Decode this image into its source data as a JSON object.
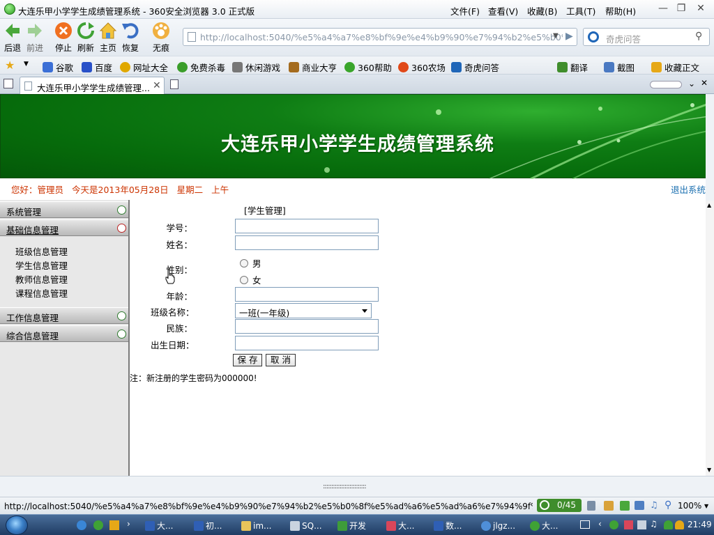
{
  "window": {
    "title": "大连乐甲小学学生成绩管理系统 - 360安全浏览器 3.0 正式版",
    "menus": [
      "文件(F)",
      "查看(V)",
      "收藏(B)",
      "工具(T)",
      "帮助(H)"
    ]
  },
  "toolbar": {
    "back": "后退",
    "forward": "前进",
    "stop": "停止",
    "refresh": "刷新",
    "home": "主页",
    "restore": "恢复",
    "incognito": "无痕"
  },
  "address": {
    "url": "http://localhost:5040/%e5%a4%a7%e8%bf%9e%e4%b9%90%e7%94%b2%e5%b0%",
    "search_placeholder": "奇虎问答"
  },
  "favorites": [
    "谷歌",
    "百度",
    "网址大全",
    "免费杀毒",
    "休闲游戏",
    "商业大亨",
    "360帮助",
    "360农场",
    "奇虎问答"
  ],
  "tools_right": [
    "翻译",
    "截图",
    "收藏正文"
  ],
  "tab": {
    "title": "大连乐甲小学学生成绩管理..."
  },
  "page": {
    "banner_title": "大连乐甲小学学生成绩管理系统",
    "greeting": {
      "user": "您好：管理员",
      "date": "今天是2013年05月28日",
      "weekday": "星期二",
      "period": "上午"
    },
    "logout": "退出系统",
    "sidebar": {
      "sections": [
        {
          "label": "系统管理"
        },
        {
          "label": "基础信息管理"
        },
        {
          "label": "工作信息管理"
        },
        {
          "label": "综合信息管理"
        }
      ],
      "sub_items": [
        "班级信息管理",
        "学生信息管理",
        "教师信息管理",
        "课程信息管理"
      ]
    },
    "form": {
      "title": "[学生管理]",
      "labels": {
        "id": "学号：",
        "name": "姓名：",
        "gender": "性别：",
        "age": "年龄：",
        "class": "班级名称：",
        "ethnicity": "民族：",
        "birth": "出生日期："
      },
      "gender_options": [
        "男",
        "女"
      ],
      "class_value": "一班(一年级)",
      "save": "保 存",
      "cancel": "取 消",
      "note": "注：新注册的学生密码为000000!"
    }
  },
  "status": {
    "url": "http://localhost:5040/%e5%a4%a7%e8%bf%9e%e4%b9%90%e7%94%b2%e5%b0%8f%e5%ad%a6%e5%ad%a6%e7%94%9f%...",
    "counter": "0/45",
    "zoom": "100%"
  },
  "taskbar": {
    "items": [
      "大...",
      "初...",
      "im...",
      "SQ...",
      "开发",
      "大...",
      "数...",
      "jlgz...",
      "大..."
    ],
    "clock": "21:49"
  },
  "colors": {
    "banner": "#0a7a10",
    "greeting": "#cc3300",
    "link": "#1a6fb0"
  }
}
